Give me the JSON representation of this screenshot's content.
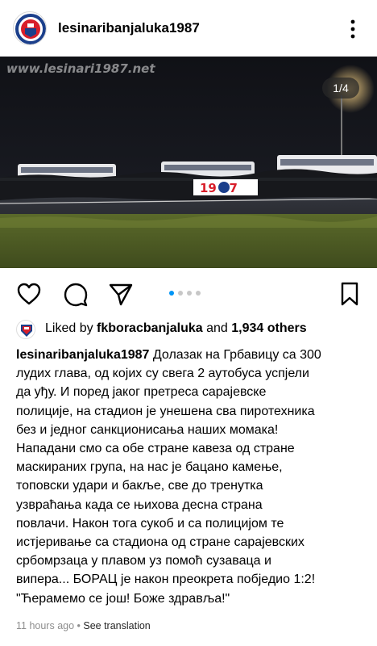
{
  "header": {
    "username": "lesinaribanjaluka1987",
    "avatar_icon": "club-crest-icon",
    "more_icon": "more-vertical-icon"
  },
  "post": {
    "watermark": "www.lesinari1987.net",
    "carousel_counter": "1/4",
    "banner_text": "19 87",
    "carousel_current": 1,
    "carousel_total": 4
  },
  "actions": {
    "like_icon": "heart-icon",
    "comment_icon": "comment-icon",
    "share_icon": "share-icon",
    "save_icon": "bookmark-icon"
  },
  "likes": {
    "prefix": "Liked by",
    "user": "fkboracbanjaluka",
    "middle": "and",
    "count": "1,934 others"
  },
  "caption": {
    "username": "lesinaribanjaluka1987",
    "lines": [
      " Долазак на Грбавицу са 300",
      "лудих глава, од којих су свега 2 аутобуса успјели",
      "да уђу. И поред јаког претреса сарајевске",
      "полиције, на стадион је унешена сва пиротехника",
      "без и једног санкционисања наших момака!",
      "Нападани смо са обе стране кавеза од стране",
      "маскираних група, на нас је бацано камење,",
      "топовски удари и бакље, све до тренутка",
      "узвраћања када се њихова десна страна",
      "повлачи. Након тога сукоб и са полицијом те",
      "истјеривање са стадиона од стране сарајевских",
      "србомрзаца у плавом уз помоћ сузаваца и",
      "випера... БОРАЦ је након преокрета побједио 1:2!",
      "\"Ћерамемо се још! Боже здравља!\""
    ]
  },
  "meta": {
    "time": "11 hours ago",
    "separator": " • ",
    "translate": "See translation"
  },
  "colors": {
    "accent": "#0095f6",
    "meta_gray": "#8e8e8e",
    "club_red": "#d81e2a",
    "club_blue": "#1b3f8b"
  }
}
